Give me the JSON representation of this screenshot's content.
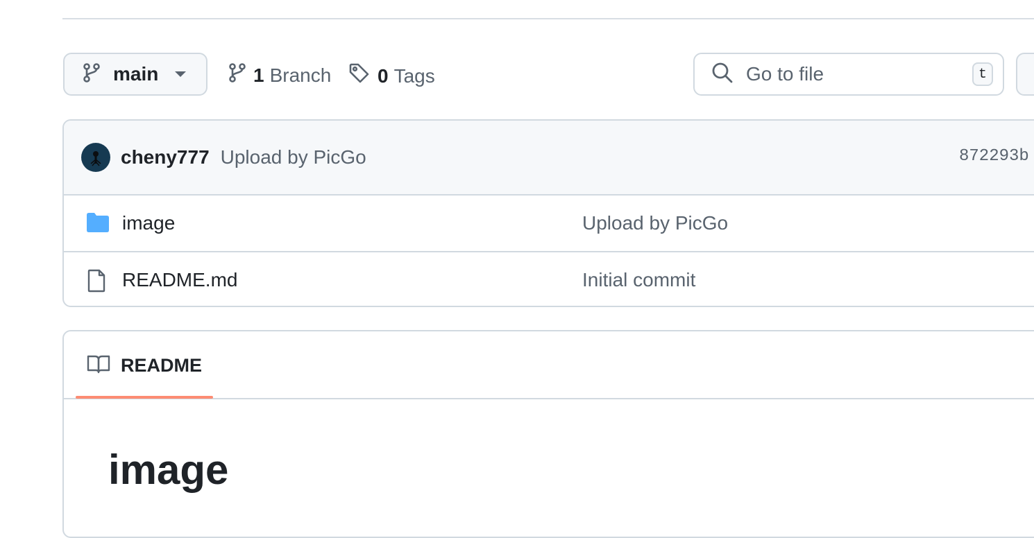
{
  "toolbar": {
    "branch_selected": "main",
    "branch_count": "1",
    "branch_label": "Branch",
    "tag_count": "0",
    "tag_label": "Tags",
    "goto_placeholder": "Go to file",
    "goto_shortcut": "t"
  },
  "commit": {
    "author": "cheny777",
    "message": "Upload by PicGo",
    "sha": "872293b"
  },
  "files": [
    {
      "name": "image",
      "type": "folder",
      "message": "Upload by PicGo"
    },
    {
      "name": "README.md",
      "type": "file",
      "message": "Initial commit"
    }
  ],
  "readme": {
    "tab_label": "README",
    "heading": "image"
  },
  "colors": {
    "folder_icon": "#54aeff",
    "tab_underline": "#fd8c73",
    "border": "#d1d9e0"
  }
}
